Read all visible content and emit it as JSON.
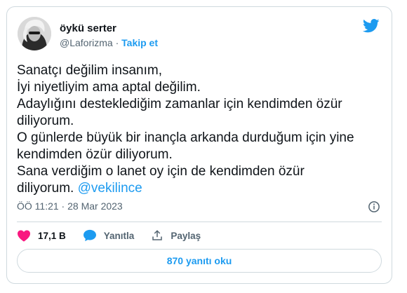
{
  "user": {
    "name": "öykü serter",
    "handle": "@Laforizma",
    "separator": "·",
    "follow_label": "Takip et"
  },
  "tweet": {
    "lines": [
      "Sanatçı değilim insanım,",
      "İyi niyetliyim ama aptal değilim.",
      "Adaylığını desteklediğim zamanlar için kendimden özür",
      "diliyorum.",
      "O günlerde büyük bir inançla arkanda durduğum için yine",
      "kendimden özür diliyorum.",
      "Sana verdiğim o lanet oy için de kendimden özür"
    ],
    "last_line_text": "diliyorum.",
    "mention": "@vekilince"
  },
  "meta": {
    "timestamp": "ÖÖ 11:21 · 28 Mar 2023"
  },
  "actions": {
    "likes": "17,1 B",
    "reply_label": "Yanıtla",
    "share_label": "Paylaş"
  },
  "replies_button": "870 yanıtı oku",
  "colors": {
    "accent": "#1d9bf0",
    "like": "#f91880",
    "text": "#0f1419",
    "secondary": "#536471",
    "border": "#cfd9de"
  },
  "icons": [
    "twitter-bird-icon",
    "info-icon",
    "heart-icon",
    "reply-bubble-icon",
    "share-icon"
  ]
}
